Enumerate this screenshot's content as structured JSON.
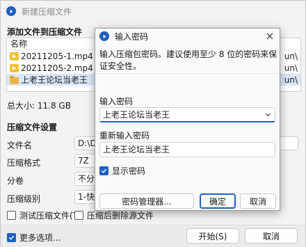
{
  "main": {
    "title": "新建压缩文件",
    "files_section": "添加文件到压缩文件",
    "filelist": {
      "header": "名称",
      "rows": [
        {
          "name": "20211205-1.mp4",
          "type": "mp4",
          "trail": "un\\"
        },
        {
          "name": "20211205-2.mp4",
          "type": "mp4",
          "trail": "un\\"
        },
        {
          "name": "上老王论坛当老王",
          "type": "folder",
          "trail": "un\\"
        }
      ]
    },
    "total_size": "总大小: 11.8 GB",
    "settings_section": "压缩文件设置",
    "filename_label": "文件名",
    "filename_value": "D:\\Dov",
    "format_label": "压缩格式",
    "format_value": "7Z",
    "split_label": "分卷",
    "split_value": "不分卷",
    "level_label": "压缩级别",
    "level_value": "1-快速",
    "test_archive": "测试压缩文件(T)",
    "delete_after": "压缩后删除源文件",
    "more_options": "更多选项...",
    "start_button": "开始(S)",
    "cancel_button": "取消"
  },
  "dialog": {
    "title": "输入密码",
    "description": "输入压缩包密码。建议使用至少 8 位的密码来保证安全性。",
    "password_label": "输入密码",
    "password_value": "上老王论坛当老王",
    "reenter_label": "重新输入密码",
    "reenter_value": "上老王论坛当老王",
    "show_password": "显示密码",
    "manager_button": "密码管理器...",
    "ok_button": "确定",
    "cancel_button": "取消"
  },
  "colors": {
    "accent": "#1f5fbf"
  }
}
